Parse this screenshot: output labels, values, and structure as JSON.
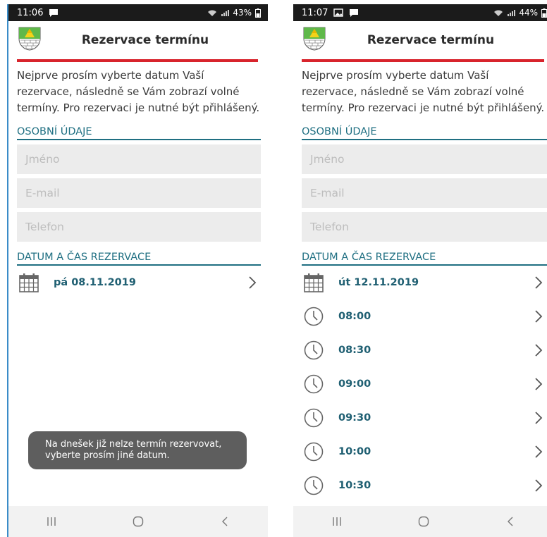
{
  "left": {
    "status": {
      "time": "11:06",
      "battery": "43%",
      "icons": [
        "chat-icon"
      ]
    },
    "appbar": {
      "title": "Rezervace termínu"
    },
    "intro": "Nejprve prosím vyberte datum Vaší rezervace, následně se Vám zobrazí volné termíny. Pro rezervaci je nutné být přihlášený.",
    "personal": {
      "heading": "OSOBNÍ ÚDAJE",
      "name_placeholder": "Jméno",
      "email_placeholder": "E-mail",
      "phone_placeholder": "Telefon"
    },
    "datetime": {
      "heading": "DATUM A ČAS REZERVACE",
      "date": "pá 08.11.2019"
    },
    "toast": "Na dnešek již nelze termín rezervovat, vyberte prosím jiné datum."
  },
  "right": {
    "status": {
      "time": "11:07",
      "battery": "44%",
      "icons": [
        "image-icon",
        "chat-icon"
      ]
    },
    "appbar": {
      "title": "Rezervace termínu"
    },
    "intro": "Nejprve prosím vyberte datum Vaší rezervace, následně se Vám zobrazí volné termíny. Pro rezervaci je nutné být přihlášený.",
    "personal": {
      "heading": "OSOBNÍ ÚDAJE",
      "name_placeholder": "Jméno",
      "email_placeholder": "E-mail",
      "phone_placeholder": "Telefon"
    },
    "datetime": {
      "heading": "DATUM A ČAS REZERVACE",
      "date": "út 12.11.2019",
      "slots": [
        "08:00",
        "08:30",
        "09:00",
        "09:30",
        "10:00",
        "10:30"
      ]
    }
  },
  "colors": {
    "accent": "#1f6f82",
    "header_line": "#d8242c",
    "toast_bg": "#5e5e5e"
  }
}
